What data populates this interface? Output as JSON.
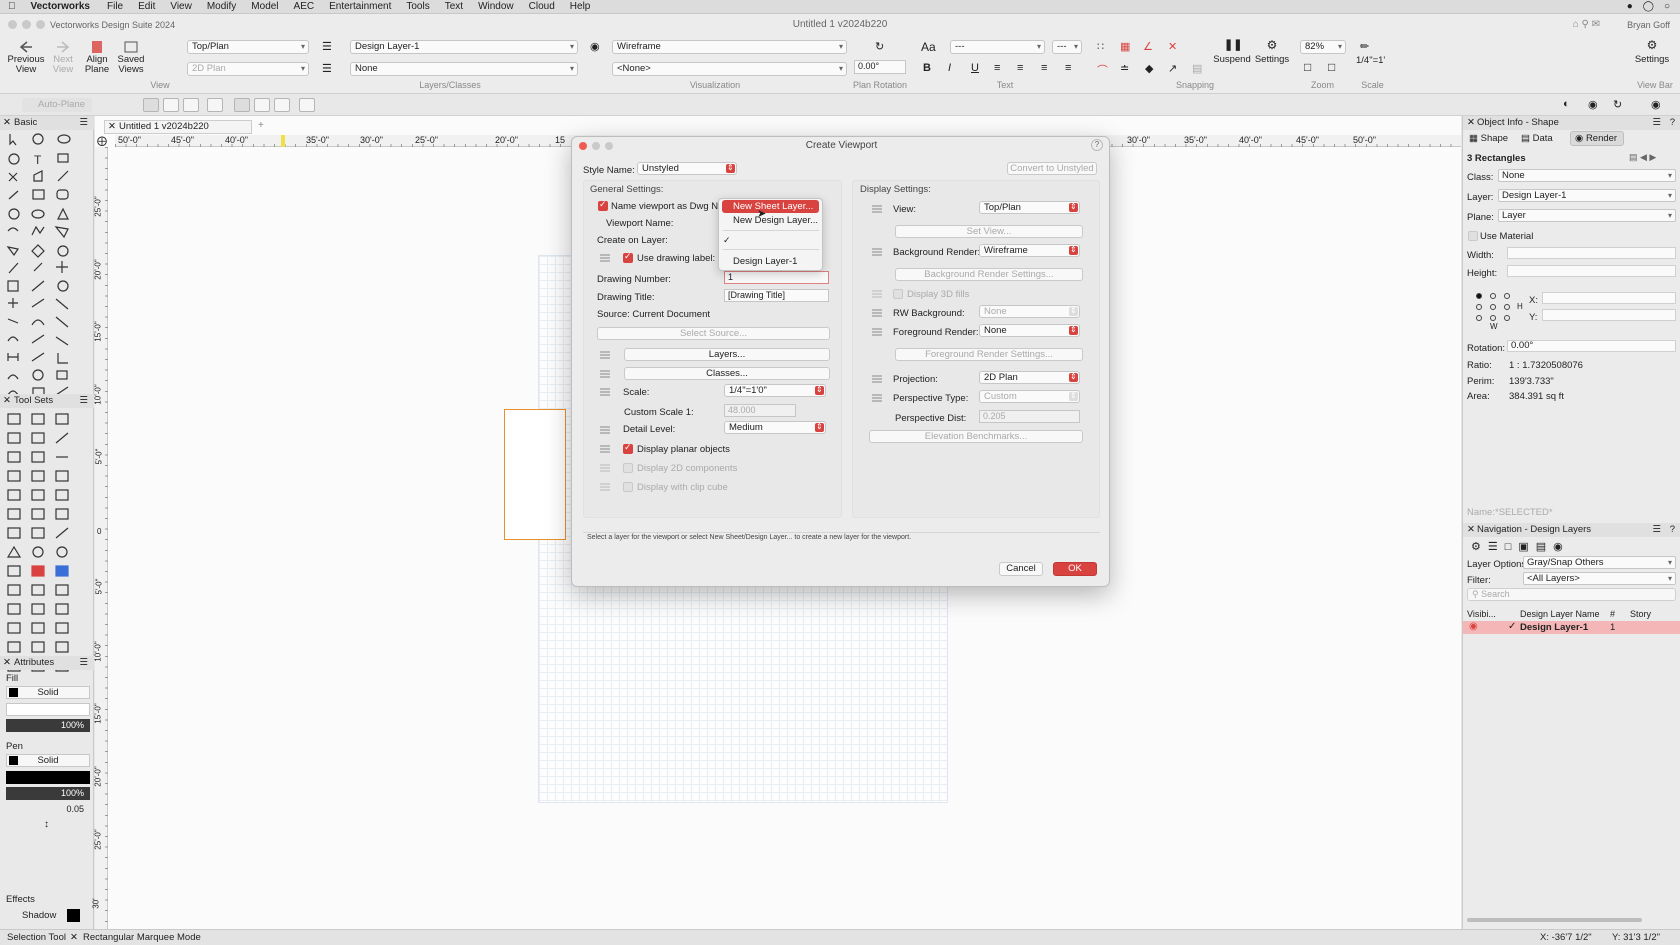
{
  "menubar": {
    "app": "Vectorworks",
    "items": [
      "File",
      "Edit",
      "View",
      "Modify",
      "Model",
      "AEC",
      "Entertainment",
      "Tools",
      "Text",
      "Window",
      "Cloud",
      "Help"
    ]
  },
  "window": {
    "app_title": "Vectorworks Design Suite 2024",
    "title": "Untitled 1 v2024b220",
    "user": "Bryan Goff"
  },
  "toolbar": {
    "previous_view": "Previous\nView",
    "next_view": "Next\nView",
    "align_plane": "Align\nPlane",
    "saved_views": "Saved\nViews",
    "view_select": "Top/Plan",
    "render_mode_2": "2D Plan",
    "view_group": "View",
    "layer_select": "Design Layer-1",
    "class_select": "None",
    "layers_classes_group": "Layers/Classes",
    "render_select": "Wireframe",
    "render_none_select": "<None>",
    "visualization_group": "Visualization",
    "plan_rotation_value": "0.00°",
    "plan_rotation_group": "Plan Rotation",
    "font_size": "---",
    "font_style": "---",
    "text_group": "Text",
    "suspend": "Suspend",
    "settings": "Settings",
    "snapping_group": "Snapping",
    "zoom_value": "82%",
    "zoom_group": "Zoom",
    "scale_value": "1/4\"=1'",
    "scale_group": "Scale",
    "settings_right": "Settings",
    "viewbar_group": "View Bar"
  },
  "row3": {
    "auto_plane": "Auto-Plane"
  },
  "left": {
    "basic_title": "Basic",
    "toolsets_title": "Tool Sets",
    "attributes_title": "Attributes",
    "fill_label": "Fill",
    "fill_type": "Solid",
    "fill_opacity": "100%",
    "pen_label": "Pen",
    "pen_type": "Solid",
    "pen_opacity": "100%",
    "line_weight": "0.05",
    "effects_label": "Effects",
    "shadow_label": "Shadow"
  },
  "tab": {
    "title": "Untitled 1 v2024b220"
  },
  "ruler": {
    "top_labels": [
      "50'-0\"",
      "45'-0\"",
      "40'-0\"",
      "35'-0\"",
      "30'-0\"",
      "25'-0\"",
      "20'-0\"",
      "15",
      "30'-0\"",
      "35'-0\"",
      "40'-0\"",
      "45'-0\"",
      "50'-0\""
    ],
    "left_labels": [
      "25'-0\"",
      "20'-0\"",
      "15'-0\"",
      "10'-0\"",
      "5'-0\"",
      "0",
      "5'-0\"",
      "10'-0\"",
      "15'-0\"",
      "20'-0\"",
      "25'-0\"",
      "30'"
    ]
  },
  "dialog": {
    "title": "Create Viewport",
    "style_name_label": "Style Name:",
    "style_name_value": "Unstyled",
    "convert_button": "Convert to Unstyled",
    "general_settings": "General Settings:",
    "name_as_dwg": "Name viewport as Dwg No.",
    "viewport_name": "Viewport Name:",
    "create_on_layer": "Create on Layer:",
    "use_drawing_label": "Use drawing label:",
    "drawing_number_label": "Drawing Number:",
    "drawing_number_value": "1",
    "drawing_title_label": "Drawing Title:",
    "drawing_title_value": "[Drawing Title]",
    "source_label": "Source:  Current Document",
    "select_source": "Select Source...",
    "layers_button": "Layers...",
    "classes_button": "Classes...",
    "scale_label": "Scale:",
    "scale_value": "1/4\"=1'0\"",
    "custom_scale_label": "Custom Scale 1:",
    "custom_scale_value": "48.000",
    "detail_level_label": "Detail Level:",
    "detail_level_value": "Medium",
    "display_planar": "Display planar objects",
    "display_2d": "Display 2D components",
    "display_clip": "Display with clip cube",
    "display_settings": "Display Settings:",
    "view_label": "View:",
    "view_value": "Top/Plan",
    "set_view": "Set View...",
    "bg_render_label": "Background Render:",
    "bg_render_value": "Wireframe",
    "bg_render_settings": "Background Render Settings...",
    "display_3d_fills": "Display 3D fills",
    "rw_background_label": "RW Background:",
    "rw_background_value": "None",
    "fg_render_label": "Foreground Render:",
    "fg_render_value": "None",
    "fg_render_settings": "Foreground Render Settings...",
    "projection_label": "Projection:",
    "projection_value": "2D Plan",
    "perspective_type_label": "Perspective Type:",
    "perspective_type_value": "Custom",
    "perspective_dist_label": "Perspective Dist:",
    "perspective_dist_value": "0.205",
    "elevation_benchmarks": "Elevation Benchmarks...",
    "hint": "Select a layer for the viewport or select New Sheet/Design Layer... to create a new layer for the viewport.",
    "cancel": "Cancel",
    "ok": "OK"
  },
  "layer_menu": {
    "items": [
      "New Sheet Layer...",
      "New Design Layer...",
      "Design Layer-1"
    ]
  },
  "right": {
    "oip_title": "Object Info - Shape",
    "tab_shape": "Shape",
    "tab_data": "Data",
    "tab_render": "Render",
    "selection": "3 Rectangles",
    "class_label": "Class:",
    "class_value": "None",
    "layer_label": "Layer:",
    "layer_value": "Design Layer-1",
    "plane_label": "Plane:",
    "plane_value": "Layer",
    "use_material": "Use Material",
    "width_label": "Width:",
    "height_label": "Height:",
    "x_label": "X:",
    "y_label": "Y:",
    "h_label": "H",
    "w_label": "W",
    "rotation_label": "Rotation:",
    "rotation_value": "0.00°",
    "ratio_label": "Ratio:",
    "ratio_value": "1 : 1.7320508076",
    "perim_label": "Perim:",
    "perim_value": "139'3.733\"",
    "area_label": "Area:",
    "area_value": "384.391 sq ft",
    "name_label": "Name:",
    "name_value": "*SELECTED*",
    "nav_title": "Navigation - Design Layers",
    "layer_options_label": "Layer Options:",
    "layer_options_value": "Gray/Snap Others",
    "filter_label": "Filter:",
    "filter_value": "<All Layers>",
    "search_placeholder": "Search",
    "col_visibility": "Visibi...",
    "col_name": "Design Layer Name",
    "col_num": "#",
    "col_story": "Story",
    "row_name": "Design Layer-1",
    "row_num": "1"
  },
  "status": {
    "tool": "Selection Tool",
    "mode": "Rectangular Marquee Mode",
    "x": "X: -36'7 1/2\"",
    "y": "Y: 31'3 1/2\""
  },
  "colors": {
    "accent": "#d9433f",
    "layer_row": "#f4b6b6",
    "drawing_rect": "#e8912c"
  }
}
